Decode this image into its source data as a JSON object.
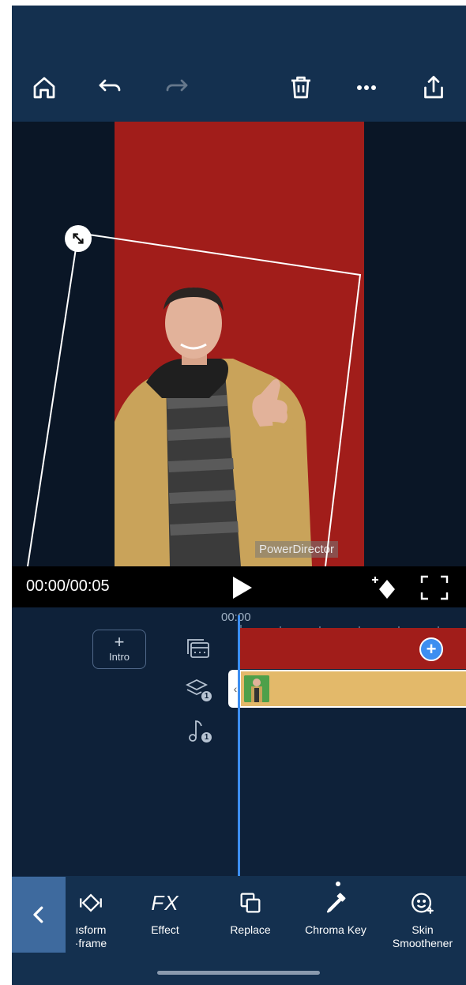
{
  "playback": {
    "timecode": "00:00/00:05"
  },
  "preview": {
    "watermark": "PowerDirector"
  },
  "timeline": {
    "time_marker": "00:00",
    "intro_plus": "+",
    "intro_label": "Intro",
    "add_symbol": "+",
    "overlay_handle": "‹",
    "overlay_badge": "1",
    "audio_badge": "1"
  },
  "tools": [
    {
      "icon": "transform-icon",
      "label_line1": "ısform",
      "label_line2": "·frame"
    },
    {
      "icon": "fx-icon",
      "glyph": "FX",
      "label_line1": "Effect",
      "label_line2": ""
    },
    {
      "icon": "replace-icon",
      "label_line1": "Replace",
      "label_line2": ""
    },
    {
      "icon": "eyedropper-icon",
      "label_line1": "Chroma Key",
      "label_line2": ""
    },
    {
      "icon": "face-icon",
      "label_line1": "Skin",
      "label_line2": "Smoothener"
    }
  ],
  "colors": {
    "accent_blue": "#3d8ef0",
    "toolbar_bg": "#14304f",
    "video_clip": "#a11d1a",
    "overlay_clip": "#e3b96a"
  }
}
